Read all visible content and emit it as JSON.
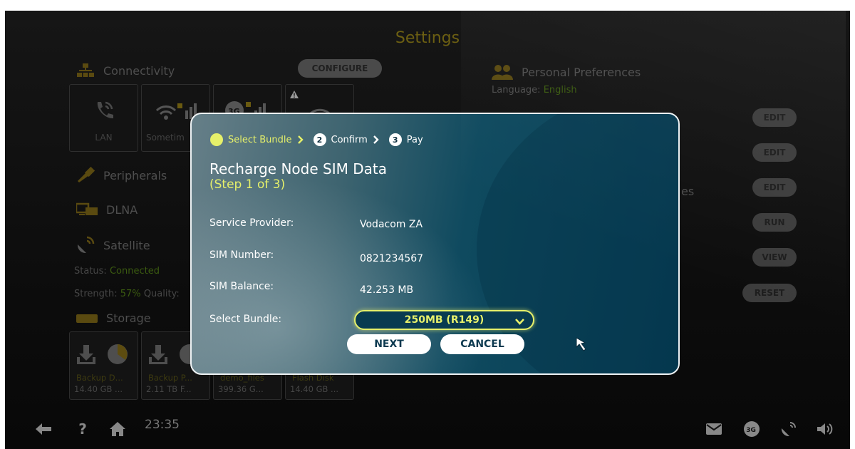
{
  "screen": {
    "title": "Settings",
    "sections": {
      "connectivity": {
        "label": "Connectivity",
        "configure_label": "CONFIGURE",
        "tiles": [
          {
            "label": "LAN",
            "icon": "phone-ethernet-icon"
          },
          {
            "label": "Sometim",
            "icon": "wifi-locked-icon"
          },
          {
            "label": "",
            "icon": "3g-signal-locked-icon"
          },
          {
            "label": "",
            "icon": "wifi-warning-icon"
          }
        ]
      },
      "peripherals": {
        "label": "Peripherals"
      },
      "dlna": {
        "label": "DLNA"
      },
      "satellite": {
        "label": "Satellite",
        "status_label": "Status:",
        "status_value": "Connected",
        "strength_label": "Strength:",
        "strength_value": "57%",
        "quality_label": "Quality:"
      },
      "storage": {
        "label": "Storage",
        "tiles": [
          {
            "name": "Backup D...",
            "size": "14.40 GB ..."
          },
          {
            "name": "Backup P...",
            "size": "2.11 TB F..."
          },
          {
            "name": "demo_files",
            "size": "399.36 G..."
          },
          {
            "name": "Flash Disk",
            "size": "14.40 GB ..."
          }
        ]
      },
      "personal_preferences": {
        "label": "Personal Preferences",
        "language_label": "Language:",
        "language_value": "English",
        "partial_text": "es"
      }
    },
    "right_buttons": [
      "EDIT",
      "EDIT",
      "EDIT",
      "RUN",
      "VIEW",
      "RESET"
    ],
    "bottom_bar": {
      "clock": "23:35",
      "icons": [
        "back-arrow-icon",
        "help-icon",
        "home-icon",
        "mail-icon",
        "3g-icon",
        "satellite-icon",
        "volume-icon"
      ]
    }
  },
  "dialog": {
    "steps": [
      {
        "num": "1",
        "label": "Select Bundle"
      },
      {
        "num": "2",
        "label": "Confirm"
      },
      {
        "num": "3",
        "label": "Pay"
      }
    ],
    "title": "Recharge Node SIM Data",
    "subtitle": "(Step 1 of 3)",
    "fields": [
      {
        "label": "Service Provider:",
        "value": "Vodacom ZA"
      },
      {
        "label": "SIM Number:",
        "value": "0821234567"
      },
      {
        "label": "SIM Balance:",
        "value": "42.253 MB"
      }
    ],
    "bundle_label": "Select Bundle:",
    "bundle_value": "250MB (R149)",
    "next_label": "NEXT",
    "cancel_label": "CANCEL"
  },
  "colors": {
    "accent_yellow": "#e6f06a",
    "dialog_blue": "#063d55",
    "status_green": "#3b5b10"
  }
}
